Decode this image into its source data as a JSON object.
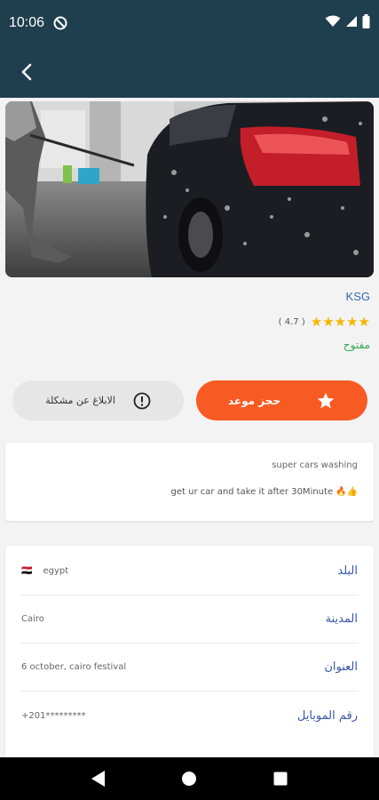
{
  "status_bar": {
    "time": "10:06"
  },
  "shop": {
    "name": "KSG",
    "stars": "★★★★★",
    "rating": "( 4.7 )",
    "status": "مفتوح"
  },
  "actions": {
    "report_label": "الابلاغ عن مشكلة",
    "book_label": "حجز موعد"
  },
  "description": {
    "title": "super cars washing",
    "text": "get ur car and take it after 30Minute",
    "emoji": "🔥👍"
  },
  "details": [
    {
      "label": "البلد",
      "value": "egypt",
      "flag": "🇪🇬"
    },
    {
      "label": "المدينة",
      "value": "Cairo"
    },
    {
      "label": "العنوان",
      "value": "6 october, cairo festival"
    },
    {
      "label": "رقم الموبايل",
      "value": "+201*********"
    }
  ],
  "colors": {
    "header": "#1f3f4f",
    "accent": "#f75a22",
    "label_blue": "#3a58a8",
    "open_green": "#3aa853",
    "star": "#f4b400"
  }
}
